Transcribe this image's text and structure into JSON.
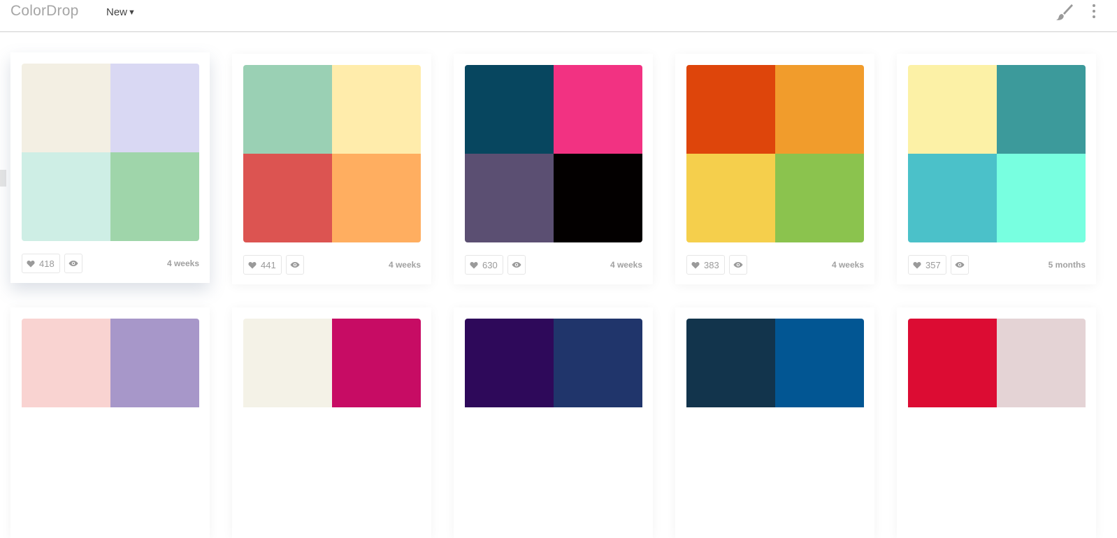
{
  "header": {
    "logo": "ColorDrop",
    "sort_label": "New",
    "sort_chevron": "❯",
    "icons": [
      "paint-brush-icon",
      "more-vertical-icon"
    ]
  },
  "palettes": [
    {
      "likes": "418",
      "age": "4 weeks",
      "colors": [
        "#f3efe3",
        "#d9d8f3",
        "#ceeee5",
        "#9fd5aa"
      ]
    },
    {
      "likes": "441",
      "age": "4 weeks",
      "colors": [
        "#9ad0b4",
        "#ffecab",
        "#dc5451",
        "#ffae60"
      ]
    },
    {
      "likes": "630",
      "age": "4 weeks",
      "colors": [
        "#07465f",
        "#f23282",
        "#5b4f72",
        "#030000"
      ]
    },
    {
      "likes": "383",
      "age": "4 weeks",
      "colors": [
        "#de450b",
        "#f19c2c",
        "#f5cf4c",
        "#8bc34e"
      ]
    },
    {
      "likes": "357",
      "age": "5 months",
      "colors": [
        "#fcf1a6",
        "#3c9a9b",
        "#4bc1c9",
        "#78ffe0"
      ]
    },
    {
      "colors": [
        "#f9d3d1",
        "#a797c9"
      ]
    },
    {
      "colors": [
        "#f4f2e7",
        "#c70c64"
      ]
    },
    {
      "colors": [
        "#2e095a",
        "#20356b"
      ]
    },
    {
      "colors": [
        "#12344c",
        "#025693"
      ]
    },
    {
      "colors": [
        "#dc0c33",
        "#e4d3d5"
      ]
    }
  ]
}
